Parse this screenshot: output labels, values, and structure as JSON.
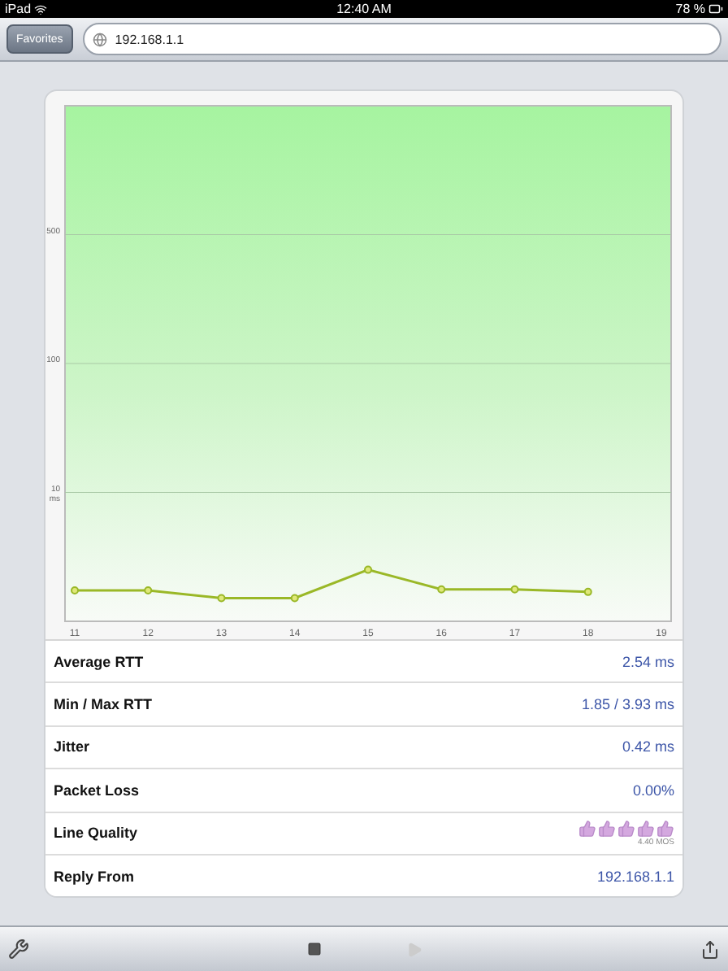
{
  "status_bar": {
    "device": "iPad",
    "time": "12:40 AM",
    "battery": "78 %"
  },
  "browser_bar": {
    "favorites": "Favorites",
    "address": "192.168.1.1"
  },
  "chart": {
    "y_axis_labels": [
      "500",
      "100",
      "10 ms"
    ],
    "x_axis_labels": [
      "11",
      "12",
      "13",
      "14",
      "15",
      "16",
      "17",
      "18",
      "19"
    ]
  },
  "stats": [
    {
      "kind": "text",
      "label": "Average RTT",
      "value": "2.54 ms"
    },
    {
      "kind": "text",
      "label": "Min / Max RTT",
      "value": "1.85 / 3.93 ms"
    },
    {
      "kind": "text",
      "label": "Jitter",
      "value": "0.42 ms"
    },
    {
      "kind": "text",
      "label": "Packet Loss",
      "value": "0.00%"
    },
    {
      "kind": "rating",
      "label": "Line Quality",
      "stars": 5,
      "value": "4.40 MOS"
    },
    {
      "kind": "text",
      "label": "Reply From",
      "value": "192.168.1.1"
    }
  ],
  "toolbar": {
    "play_disabled": true
  }
}
